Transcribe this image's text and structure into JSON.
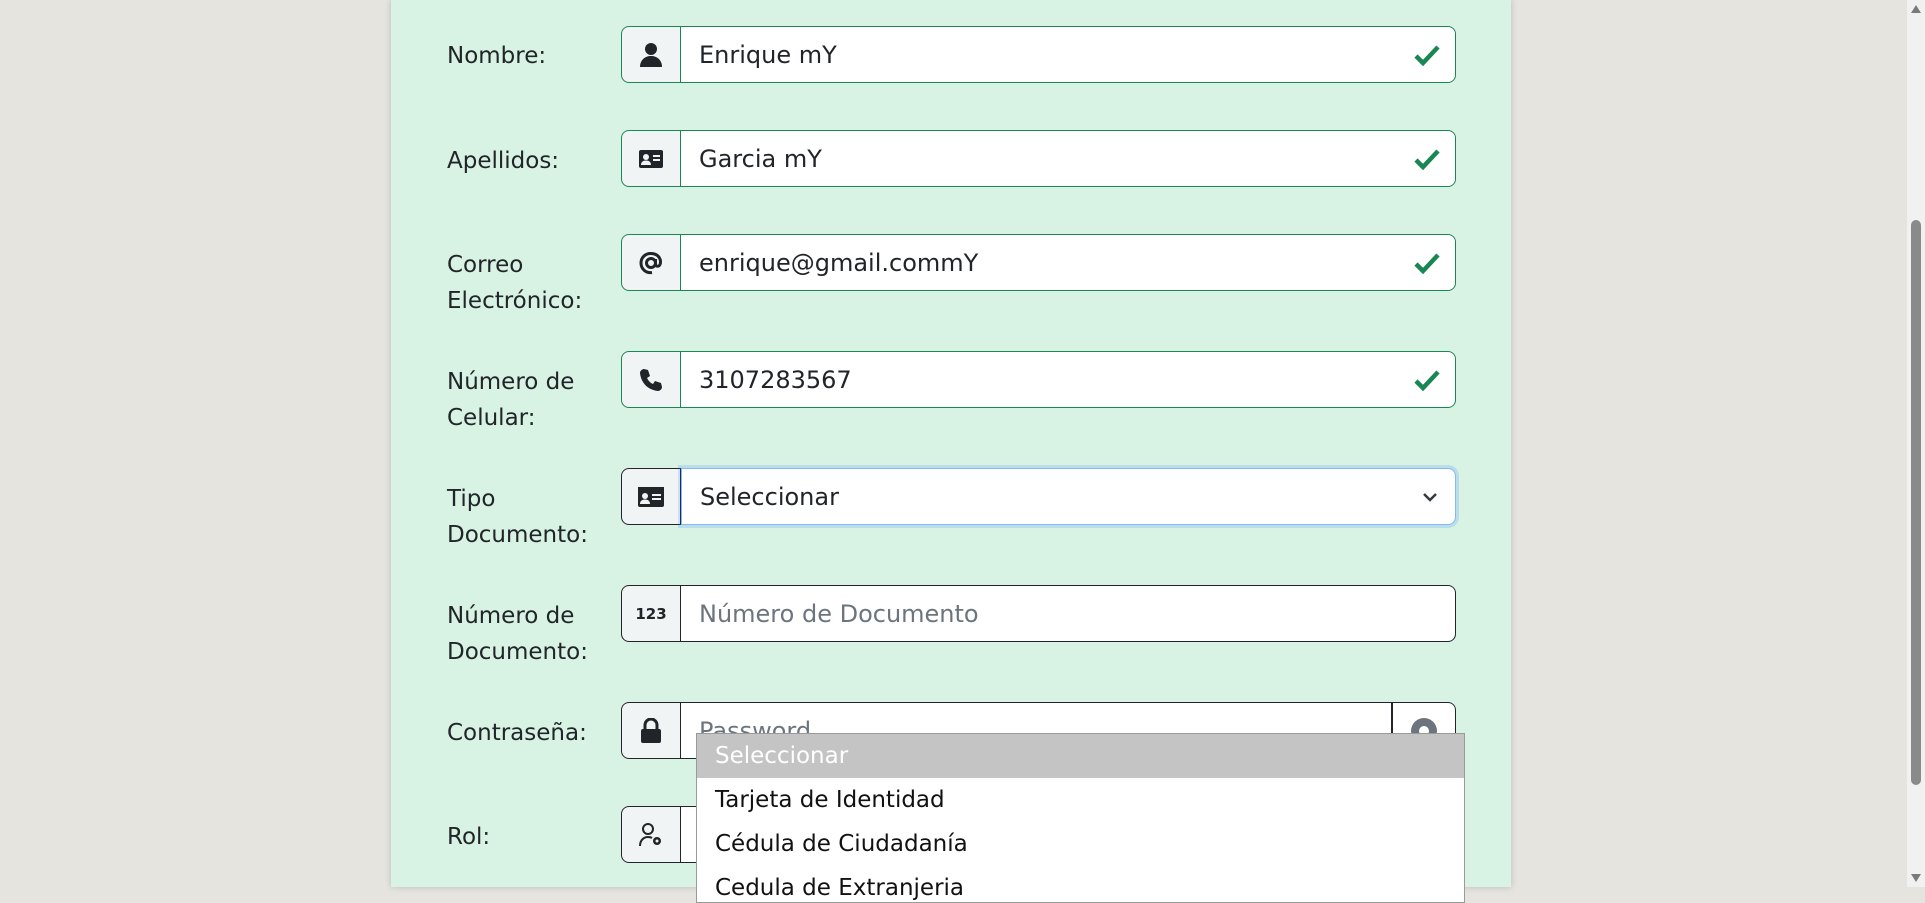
{
  "form": {
    "nombre": {
      "label": "Nombre:",
      "value": "Enrique mY"
    },
    "apellidos": {
      "label": "Apellidos:",
      "value": "Garcia mY"
    },
    "correo": {
      "label_line1": "Correo",
      "label_line2": "Electrónico:",
      "value": "enrique@gmail.commY"
    },
    "celular": {
      "label_line1": "Número de",
      "label_line2": "Celular:",
      "value": "3107283567"
    },
    "tipo_documento": {
      "label_line1": "Tipo",
      "label_line2": "Documento:",
      "selected": "Seleccionar"
    },
    "numero_documento": {
      "label_line1": "Número de",
      "label_line2": "Documento:",
      "placeholder": "Número de Documento",
      "icon_text": "123"
    },
    "contrasena": {
      "label": "Contraseña:",
      "placeholder": "Password"
    },
    "rol": {
      "label": "Rol:"
    }
  },
  "dropdown": {
    "options": [
      "Seleccionar",
      "Tarjeta de Identidad",
      "Cédula de Ciudadanía",
      "Cedula de Extranjeria"
    ]
  },
  "colors": {
    "card_background": "#d8f3e3",
    "page_background": "#e5e4df",
    "valid_green": "#198754"
  },
  "icons": {
    "nombre": "user-icon",
    "apellidos": "id-card-icon",
    "correo": "at-sign-icon",
    "celular": "phone-icon",
    "tipo_documento": "id-card-icon",
    "numero_documento": "numbers-icon",
    "contrasena": "lock-icon",
    "rol": "user-gear-icon"
  }
}
